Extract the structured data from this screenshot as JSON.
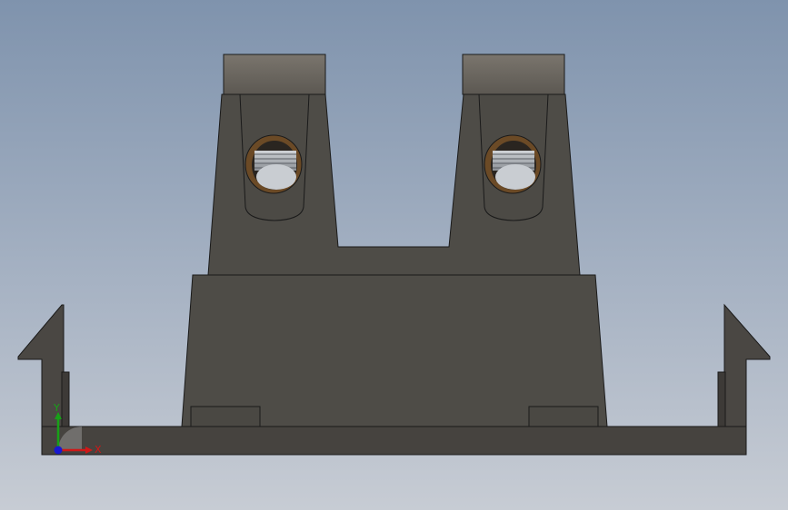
{
  "viewport": {
    "background_top": "#7f93ad",
    "background_bottom": "#c7ccd4"
  },
  "model": {
    "body_color": "#4e4c47",
    "tray_color": "#45423f",
    "tube_cap_color": "#6a665f",
    "bore_rim_color": "#6b4a26"
  },
  "triad": {
    "x_label": "X",
    "y_label": "Y",
    "x_color": "#d01818",
    "y_color": "#18a018",
    "z_color": "#1818d0"
  }
}
